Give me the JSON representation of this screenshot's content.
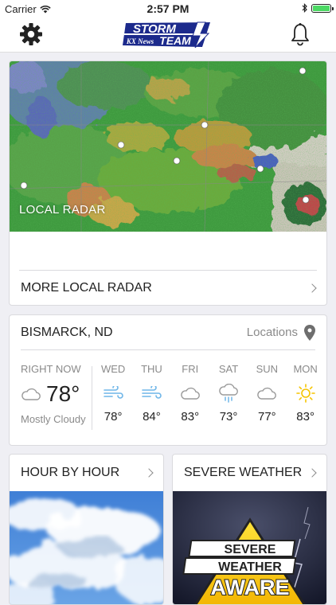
{
  "status_bar": {
    "carrier": "Carrier",
    "time": "2:57 PM",
    "battery_level": 1.0
  },
  "header": {
    "logo_text_top": "STORM",
    "logo_text_brand": "KX News",
    "logo_text_bottom": "TEAM",
    "settings_icon": "gear-icon",
    "notifications_icon": "bell-icon"
  },
  "radar": {
    "overlay_label": "LOCAL RADAR",
    "more_label": "MORE LOCAL RADAR"
  },
  "weather": {
    "location": "BISMARCK, ND",
    "locations_link": "Locations",
    "now": {
      "label": "RIGHT NOW",
      "temp": "78°",
      "condition": "Mostly Cloudy",
      "icon": "cloud-icon"
    },
    "forecast": [
      {
        "day": "WED",
        "temp": "78°",
        "icon": "wind-icon"
      },
      {
        "day": "THU",
        "temp": "84°",
        "icon": "wind-icon"
      },
      {
        "day": "FRI",
        "temp": "83°",
        "icon": "cloud-icon"
      },
      {
        "day": "SAT",
        "temp": "73°",
        "icon": "rain-cloud-icon"
      },
      {
        "day": "SUN",
        "temp": "77°",
        "icon": "cloud-icon"
      },
      {
        "day": "MON",
        "temp": "83°",
        "icon": "sun-icon"
      }
    ]
  },
  "tiles": {
    "hour_by_hour": "HOUR BY HOUR",
    "severe_weather": "SEVERE WEATHER",
    "severe_sign_lines": [
      "SEVERE",
      "WEATHER",
      "AWARE"
    ]
  },
  "colors": {
    "accent": "#1c2a8c",
    "icon_blue": "#6fb6e8",
    "sun": "#f5c400",
    "muted": "#8a8a8a"
  }
}
